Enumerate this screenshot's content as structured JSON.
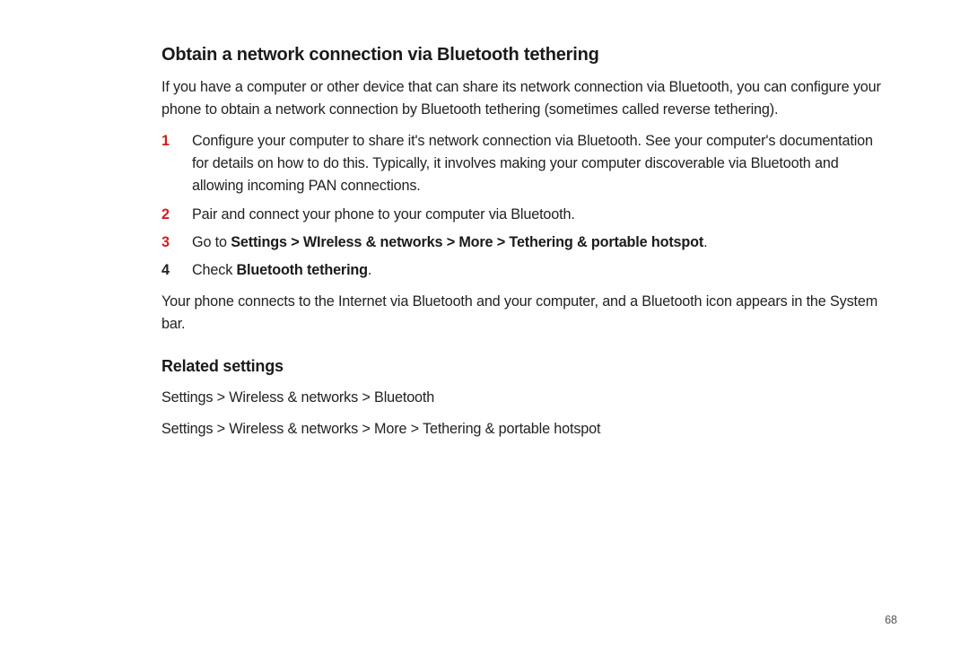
{
  "section_title": "Obtain a network connection via Bluetooth tethering",
  "intro": "If you have a computer or other device that can share its network connection via Bluetooth, you can configure your phone to obtain a network connection by Bluetooth tethering (sometimes called reverse tethering).",
  "steps": [
    {
      "num": "1",
      "num_red": true,
      "text": "Configure your computer to share it's network connection via Bluetooth. See your computer's documentation for details on how to do this. Typically, it involves making your computer discoverable via Bluetooth and allowing incoming PAN connections."
    },
    {
      "num": "2",
      "num_red": true,
      "text": "Pair and connect your phone to your computer via Bluetooth."
    },
    {
      "num": "3",
      "num_red": true,
      "pre": "Go to ",
      "bold": "Settings > WIreless & networks > More > Tethering & portable hotspot",
      "post": "."
    },
    {
      "num": "4",
      "num_red": false,
      "pre": "Check ",
      "bold": "Bluetooth tethering",
      "post": "."
    }
  ],
  "outro": "Your phone connects to the Internet via Bluetooth and your computer, and a Bluetooth icon appears in the System bar.",
  "related_heading": "Related settings",
  "related": [
    "Settings > Wireless & networks > Bluetooth",
    "Settings > Wireless & networks > More > Tethering & portable hotspot"
  ],
  "page_number": "68"
}
